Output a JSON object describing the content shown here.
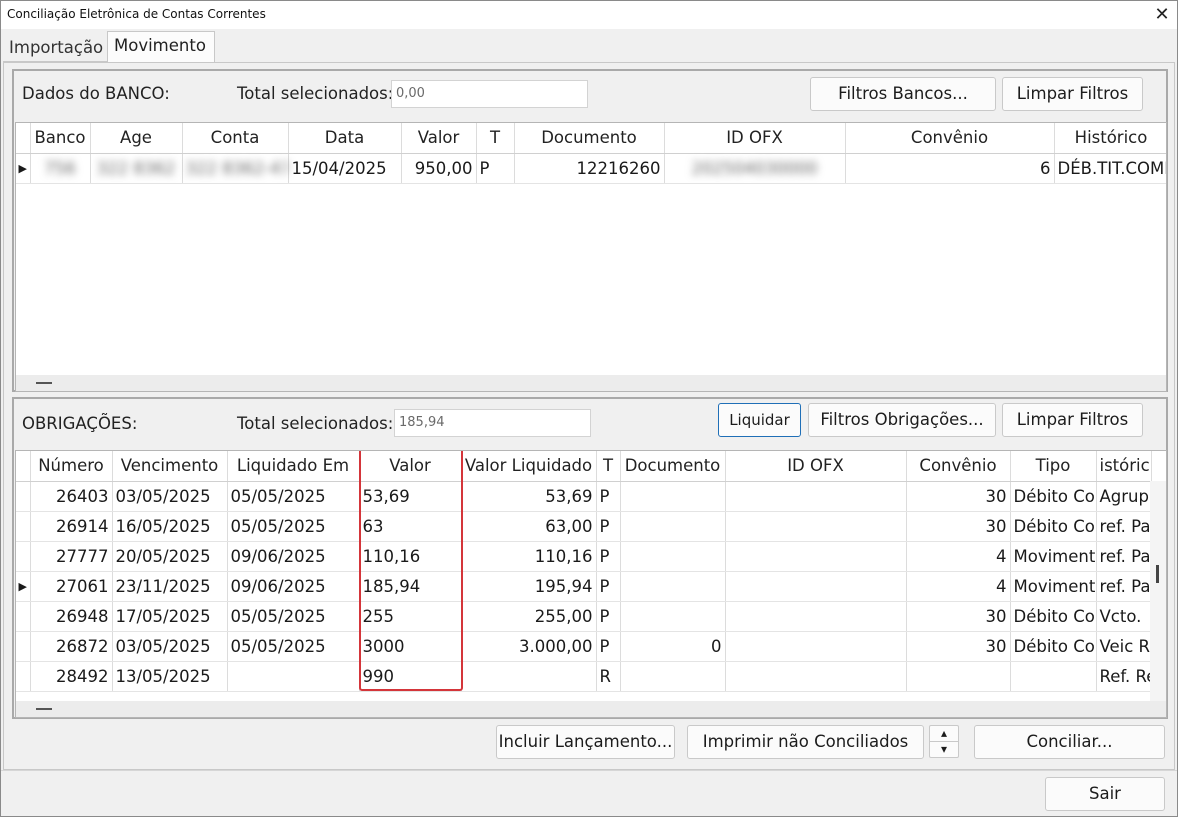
{
  "window": {
    "title": "Conciliação Eletrônica de Contas Correntes",
    "close_glyph": "✕"
  },
  "tabs": [
    {
      "label": "Importação"
    },
    {
      "label": "Movimento"
    }
  ],
  "banco": {
    "header_label": "Dados do BANCO:",
    "total_label": "Total selecionados:",
    "total_value": "0,00",
    "filter_button": "Filtros Bancos...",
    "clear_button": "Limpar Filtros",
    "columns": [
      "Banco",
      "Age",
      "Conta",
      "Data",
      "Valor",
      "T",
      "Documento",
      "ID OFX",
      "Convênio",
      "Histórico"
    ],
    "rows": [
      {
        "indicator": "▶",
        "banco": "756",
        "age": "322 8362",
        "conta": "322 8362-47",
        "data": "15/04/2025",
        "valor": "950,00",
        "t": "P",
        "documento": "12216260",
        "id_ofx": "202504030000",
        "convenio": "6",
        "historico": "DÉB.TIT.COMP"
      }
    ]
  },
  "obrigacoes": {
    "header_label": "OBRIGAÇÕES:",
    "total_label": "Total selecionados:",
    "total_value": "185,94",
    "liquidar_button": "Liquidar",
    "filter_button": "Filtros Obrigações...",
    "clear_button": "Limpar Filtros",
    "columns": [
      "Número",
      "Vencimento",
      "Liquidado Em",
      "Valor",
      "Valor Liquidado",
      "T",
      "Documento",
      "ID OFX",
      "Convênio",
      "Tipo",
      "istóric"
    ],
    "rows": [
      {
        "indicator": "",
        "numero": "26403",
        "vencimento": "03/05/2025",
        "liquidado": "05/05/2025",
        "valor": "53,69",
        "valor_liq": "53,69",
        "t": "P",
        "documento": "",
        "id_ofx": "",
        "convenio": "30",
        "tipo": "Débito Co",
        "historico": "Agrup"
      },
      {
        "indicator": "",
        "numero": "26914",
        "vencimento": "16/05/2025",
        "liquidado": "05/05/2025",
        "valor": "63",
        "valor_liq": "63,00",
        "t": "P",
        "documento": "",
        "id_ofx": "",
        "convenio": "30",
        "tipo": "Débito Co",
        "historico": "ref. Pa"
      },
      {
        "indicator": "",
        "numero": "27777",
        "vencimento": "20/05/2025",
        "liquidado": "09/06/2025",
        "valor": "110,16",
        "valor_liq": "110,16",
        "t": "P",
        "documento": "",
        "id_ofx": "",
        "convenio": "4",
        "tipo": "Moviment",
        "historico": "ref. Pa"
      },
      {
        "indicator": "▶",
        "numero": "27061",
        "vencimento": "23/11/2025",
        "liquidado": "09/06/2025",
        "valor": "185,94",
        "valor_liq": "195,94",
        "t": "P",
        "documento": "",
        "id_ofx": "",
        "convenio": "4",
        "tipo": "Moviment",
        "historico": "ref. Pa"
      },
      {
        "indicator": "",
        "numero": "26948",
        "vencimento": "17/05/2025",
        "liquidado": "05/05/2025",
        "valor": "255",
        "valor_liq": "255,00",
        "t": "P",
        "documento": "",
        "id_ofx": "",
        "convenio": "30",
        "tipo": "Débito Co",
        "historico": "Vcto."
      },
      {
        "indicator": "",
        "numero": "26872",
        "vencimento": "03/05/2025",
        "liquidado": "05/05/2025",
        "valor": "3000",
        "valor_liq": "3.000,00",
        "t": "P",
        "documento": "0",
        "id_ofx": "",
        "convenio": "30",
        "tipo": "Débito Co",
        "historico": "Veic R"
      },
      {
        "indicator": "",
        "numero": "28492",
        "vencimento": "13/05/2025",
        "liquidado": "",
        "valor": "990",
        "valor_liq": "",
        "t": "R",
        "documento": "",
        "id_ofx": "",
        "convenio": "",
        "tipo": "",
        "historico": "Ref. Re"
      }
    ]
  },
  "actions": {
    "incluir": "Incluir Lançamento...",
    "imprimir": "Imprimir não Conciliados",
    "up": "▴",
    "down": "▾",
    "conciliar": "Conciliar...",
    "sair": "Sair"
  },
  "colors": {
    "highlight_border": "#d4353a",
    "focus_border": "#1f6fb7"
  }
}
